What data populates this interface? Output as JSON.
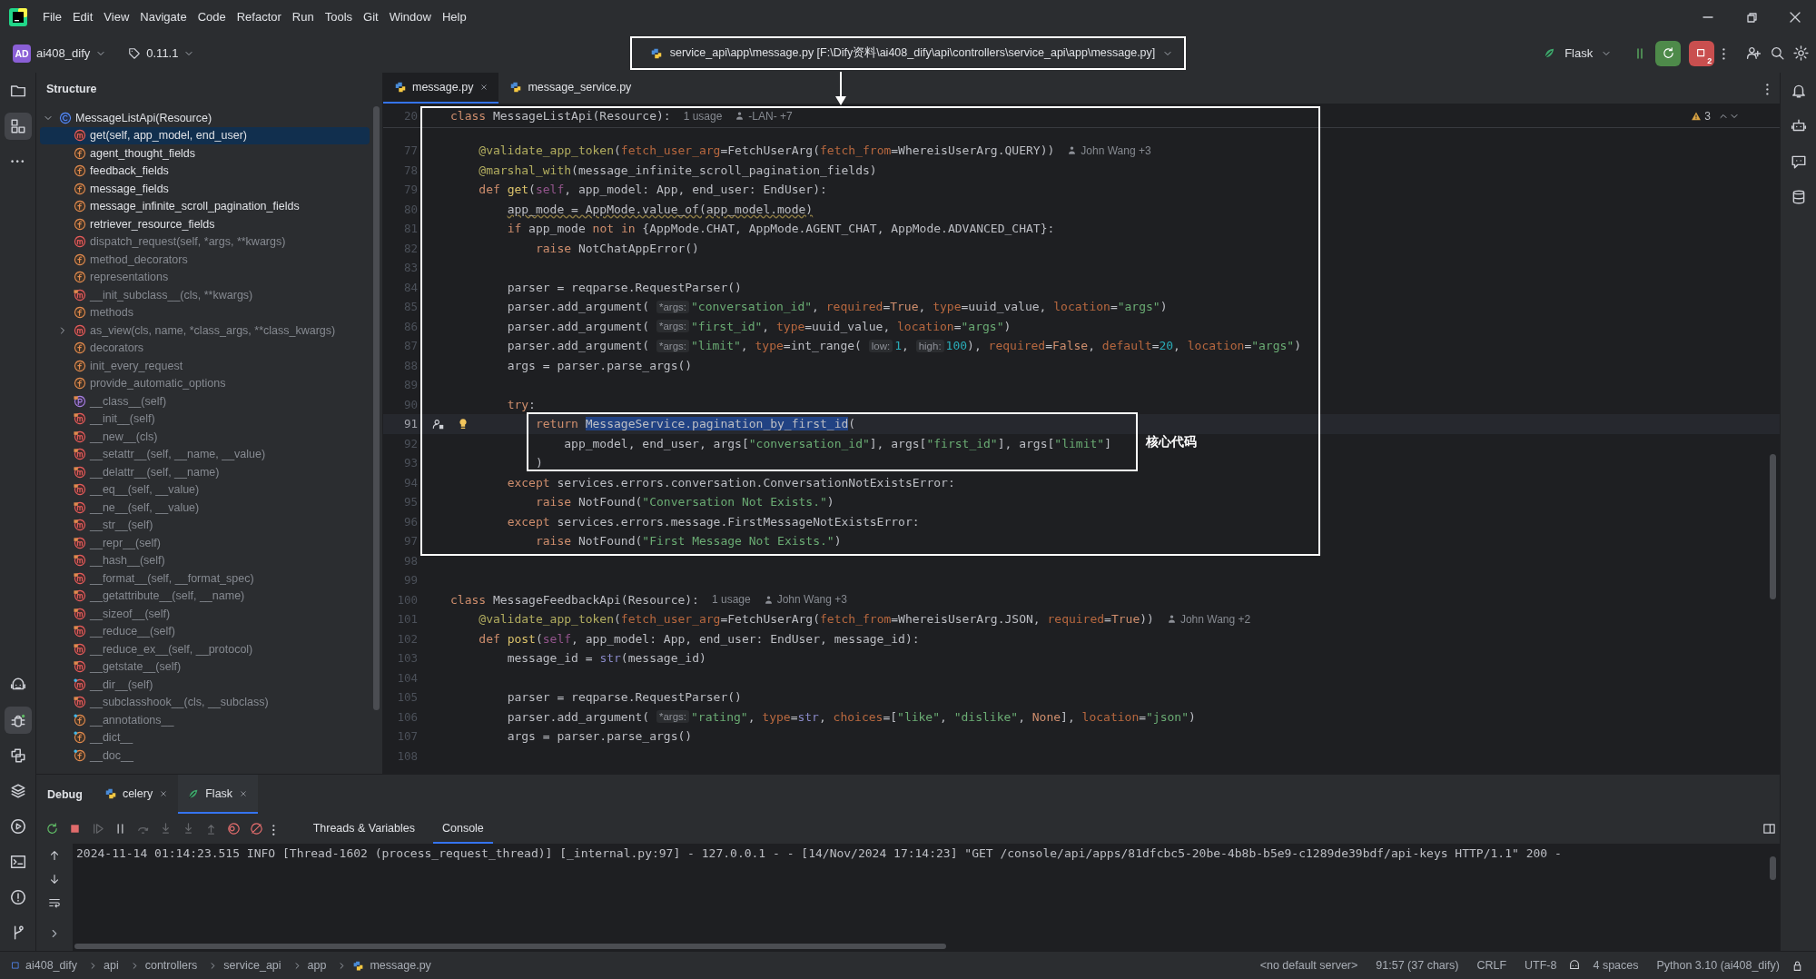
{
  "menu": [
    "File",
    "Edit",
    "View",
    "Navigate",
    "Code",
    "Refactor",
    "Run",
    "Tools",
    "Git",
    "Window",
    "Help"
  ],
  "toolbar": {
    "project_initials": "AD",
    "project": "ai408_dify",
    "version": "0.11.1",
    "file_path": "service_api\\app\\message.py [F:\\Dify资料\\ai408_dify\\api\\controllers\\service_api\\app\\message.py]",
    "run_config": "Flask",
    "stop_badge": "2"
  },
  "left_strip": {
    "top": [
      {
        "kind": "folder",
        "selected": false
      },
      {
        "kind": "structure",
        "selected": true
      },
      {
        "kind": "more",
        "selected": false
      }
    ],
    "bottom": [
      {
        "kind": "robot",
        "selected": false
      },
      {
        "kind": "bug",
        "selected": true
      },
      {
        "kind": "python",
        "selected": false
      },
      {
        "kind": "layers",
        "selected": false
      },
      {
        "kind": "run",
        "selected": false
      },
      {
        "kind": "terminal",
        "selected": false
      },
      {
        "kind": "problems",
        "selected": false
      },
      {
        "kind": "git",
        "selected": false
      }
    ]
  },
  "right_strip": [
    {
      "kind": "bell"
    },
    {
      "kind": "ai"
    },
    {
      "kind": "ai-chat"
    },
    {
      "kind": "database"
    }
  ],
  "structure": {
    "title": "Structure",
    "root": {
      "label": "MessageListApi(Resource)",
      "expanded": true,
      "children": [
        {
          "label": "get(self, app_model, end_user)",
          "kind": "method",
          "inherited": false,
          "expandable": false,
          "selected": true
        },
        {
          "label": "agent_thought_fields",
          "kind": "field",
          "inherited": false,
          "expandable": false,
          "selected": false
        },
        {
          "label": "feedback_fields",
          "kind": "field",
          "inherited": false,
          "expandable": false,
          "selected": false
        },
        {
          "label": "message_fields",
          "kind": "field",
          "inherited": false,
          "expandable": false,
          "selected": false
        },
        {
          "label": "message_infinite_scroll_pagination_fields",
          "kind": "field",
          "inherited": false,
          "expandable": false,
          "selected": false
        },
        {
          "label": "retriever_resource_fields",
          "kind": "field",
          "inherited": false,
          "expandable": false,
          "selected": false
        },
        {
          "label": "dispatch_request(self, *args, **kwargs)",
          "kind": "method",
          "inherited": true,
          "expandable": false,
          "selected": false
        },
        {
          "label": "method_decorators",
          "kind": "field",
          "inherited": true,
          "expandable": false,
          "selected": false
        },
        {
          "label": "representations",
          "kind": "field",
          "inherited": true,
          "expandable": false,
          "selected": false
        },
        {
          "label": "__init_subclass__(cls, **kwargs)",
          "kind": "method-lock",
          "inherited": true,
          "expandable": false,
          "selected": false
        },
        {
          "label": "methods",
          "kind": "field",
          "inherited": true,
          "expandable": false,
          "selected": false
        },
        {
          "label": "as_view(cls, name, *class_args, **class_kwargs)",
          "kind": "method",
          "inherited": true,
          "expandable": true,
          "selected": false
        },
        {
          "label": "decorators",
          "kind": "field",
          "inherited": true,
          "expandable": false,
          "selected": false
        },
        {
          "label": "init_every_request",
          "kind": "field",
          "inherited": true,
          "expandable": false,
          "selected": false
        },
        {
          "label": "provide_automatic_options",
          "kind": "field",
          "inherited": true,
          "expandable": false,
          "selected": false
        },
        {
          "label": "__class__(self)",
          "kind": "property-lock",
          "inherited": true,
          "expandable": false,
          "selected": false
        },
        {
          "label": "__init__(self)",
          "kind": "method-lock",
          "inherited": true,
          "expandable": false,
          "selected": false
        },
        {
          "label": "__new__(cls)",
          "kind": "method-lock",
          "inherited": true,
          "expandable": false,
          "selected": false
        },
        {
          "label": "__setattr__(self, __name, __value)",
          "kind": "method-lock",
          "inherited": true,
          "expandable": false,
          "selected": false
        },
        {
          "label": "__delattr__(self, __name)",
          "kind": "method-lock",
          "inherited": true,
          "expandable": false,
          "selected": false
        },
        {
          "label": "__eq__(self, __value)",
          "kind": "method-lock",
          "inherited": true,
          "expandable": false,
          "selected": false
        },
        {
          "label": "__ne__(self, __value)",
          "kind": "method-lock",
          "inherited": true,
          "expandable": false,
          "selected": false
        },
        {
          "label": "__str__(self)",
          "kind": "method-lock",
          "inherited": true,
          "expandable": false,
          "selected": false
        },
        {
          "label": "__repr__(self)",
          "kind": "method-lock",
          "inherited": true,
          "expandable": false,
          "selected": false
        },
        {
          "label": "__hash__(self)",
          "kind": "method-lock",
          "inherited": true,
          "expandable": false,
          "selected": false
        },
        {
          "label": "__format__(self, __format_spec)",
          "kind": "method-lock",
          "inherited": true,
          "expandable": false,
          "selected": false
        },
        {
          "label": "__getattribute__(self, __name)",
          "kind": "method-lock",
          "inherited": true,
          "expandable": false,
          "selected": false
        },
        {
          "label": "__sizeof__(self)",
          "kind": "method-lock",
          "inherited": true,
          "expandable": false,
          "selected": false
        },
        {
          "label": "__reduce__(self)",
          "kind": "method-lock",
          "inherited": true,
          "expandable": false,
          "selected": false
        },
        {
          "label": "__reduce_ex__(self, __protocol)",
          "kind": "method-lock",
          "inherited": true,
          "expandable": false,
          "selected": false
        },
        {
          "label": "__getstate__(self)",
          "kind": "method-lock",
          "inherited": true,
          "expandable": false,
          "selected": false
        },
        {
          "label": "__dir__(self)",
          "kind": "method-dot",
          "inherited": true,
          "expandable": false,
          "selected": false
        },
        {
          "label": "__subclasshook__(cls, __subclass)",
          "kind": "method-lock",
          "inherited": true,
          "expandable": false,
          "selected": false
        },
        {
          "label": "__annotations__",
          "kind": "field-dot",
          "inherited": true,
          "expandable": false,
          "selected": false
        },
        {
          "label": "__dict__",
          "kind": "field-dot",
          "inherited": true,
          "expandable": false,
          "selected": false
        },
        {
          "label": "__doc__",
          "kind": "field-dot",
          "inherited": true,
          "expandable": false,
          "selected": false
        }
      ]
    }
  },
  "editor": {
    "tabs": [
      {
        "label": "message.py",
        "selected": true,
        "closable": true
      },
      {
        "label": "message_service.py",
        "selected": false,
        "closable": false
      }
    ],
    "warnings": "3",
    "sticky_line": {
      "number": "20",
      "parts": [
        {
          "kind": "code",
          "text": "class MessageListApi(Resource):"
        }
      ],
      "usages": "1 usage",
      "blame": "-LAN- +7"
    },
    "lines": [
      {
        "number": "77",
        "current": false,
        "parts": [
          {
            "kind": "code",
            "text": "    @validate_app_token(fetch_user_arg=FetchUserArg(fetch_from=WhereisUserArg.QUERY))"
          }
        ],
        "blame": "John Wang +3"
      },
      {
        "number": "78",
        "current": false,
        "parts": [
          {
            "kind": "code",
            "text": "    @marshal_with(message_infinite_scroll_pagination_fields)"
          }
        ]
      },
      {
        "number": "79",
        "current": false,
        "parts": [
          {
            "kind": "code",
            "text": "    def get(self, app_model: App, end_user: EndUser):"
          }
        ]
      },
      {
        "number": "80",
        "current": false,
        "parts": [
          {
            "kind": "warning",
            "text": "        app_mode = AppMode.value_of(app_model.mode)"
          }
        ]
      },
      {
        "number": "81",
        "current": false,
        "parts": [
          {
            "kind": "code",
            "text": "        if app_mode not in {AppMode.CHAT, AppMode.AGENT_CHAT, AppMode.ADVANCED_CHAT}:"
          }
        ]
      },
      {
        "number": "82",
        "current": false,
        "parts": [
          {
            "kind": "code",
            "text": "            raise NotChatAppError()"
          }
        ]
      },
      {
        "number": "83",
        "current": false
      },
      {
        "number": "84",
        "current": false,
        "parts": [
          {
            "kind": "code",
            "text": "        parser = reqparse.RequestParser()"
          }
        ]
      },
      {
        "number": "85",
        "current": false,
        "parts": [
          {
            "kind": "code",
            "text": "        parser.add_argument( "
          },
          {
            "kind": "hint",
            "text": "*args:"
          },
          {
            "kind": "code",
            "text": "\"conversation_id\", required=True, type=uuid_value, location=\"args\")"
          }
        ]
      },
      {
        "number": "86",
        "current": false,
        "parts": [
          {
            "kind": "code",
            "text": "        parser.add_argument( "
          },
          {
            "kind": "hint",
            "text": "*args:"
          },
          {
            "kind": "code",
            "text": "\"first_id\", type=uuid_value, location=\"args\")"
          }
        ]
      },
      {
        "number": "87",
        "current": false,
        "parts": [
          {
            "kind": "code",
            "text": "        parser.add_argument( "
          },
          {
            "kind": "hint",
            "text": "*args:"
          },
          {
            "kind": "code",
            "text": "\"limit\", type=int_range( "
          },
          {
            "kind": "hint",
            "text": "low:"
          },
          {
            "kind": "code",
            "text": "1, "
          },
          {
            "kind": "hint",
            "text": "high:"
          },
          {
            "kind": "code",
            "text": "100), required=False, default=20, location=\"args\")"
          }
        ]
      },
      {
        "number": "88",
        "current": false,
        "parts": [
          {
            "kind": "code",
            "text": "        args = parser.parse_args()"
          }
        ]
      },
      {
        "number": "89",
        "current": false
      },
      {
        "number": "90",
        "current": false,
        "parts": [
          {
            "kind": "code",
            "text": "        try:"
          }
        ]
      },
      {
        "number": "91",
        "current": true,
        "parts": [
          {
            "kind": "code",
            "text": "            return "
          },
          {
            "kind": "selection",
            "text": "MessageService.pagination_by_first_id"
          },
          {
            "kind": "code",
            "text": "("
          }
        ]
      },
      {
        "number": "92",
        "current": false,
        "parts": [
          {
            "kind": "code",
            "text": "                app_model, end_user, args[\"conversation_id\"], args[\"first_id\"], args[\"limit\"]"
          }
        ]
      },
      {
        "number": "93",
        "current": false,
        "parts": [
          {
            "kind": "code",
            "text": "            )"
          }
        ]
      },
      {
        "number": "94",
        "current": false,
        "parts": [
          {
            "kind": "code",
            "text": "        except services.errors.conversation.ConversationNotExistsError:"
          }
        ]
      },
      {
        "number": "95",
        "current": false,
        "parts": [
          {
            "kind": "code",
            "text": "            raise NotFound(\"Conversation Not Exists.\")"
          }
        ]
      },
      {
        "number": "96",
        "current": false,
        "parts": [
          {
            "kind": "code",
            "text": "        except services.errors.message.FirstMessageNotExistsError:"
          }
        ]
      },
      {
        "number": "97",
        "current": false,
        "parts": [
          {
            "kind": "code",
            "text": "            raise NotFound(\"First Message Not Exists.\")"
          }
        ]
      },
      {
        "number": "98",
        "current": false
      },
      {
        "number": "99",
        "current": false
      },
      {
        "number": "100",
        "current": false,
        "parts": [
          {
            "kind": "code",
            "text": "class MessageFeedbackApi(Resource):"
          }
        ],
        "usages": "1 usage",
        "blame": "John Wang +3"
      },
      {
        "number": "101",
        "current": false,
        "parts": [
          {
            "kind": "code",
            "text": "    @validate_app_token(fetch_user_arg=FetchUserArg(fetch_from=WhereisUserArg.JSON, required=True))"
          }
        ],
        "blame": "John Wang +2"
      },
      {
        "number": "102",
        "current": false,
        "parts": [
          {
            "kind": "code",
            "text": "    def post(self, app_model: App, end_user: EndUser, message_id):"
          }
        ]
      },
      {
        "number": "103",
        "current": false,
        "parts": [
          {
            "kind": "code",
            "text": "        message_id = str(message_id)"
          }
        ]
      },
      {
        "number": "104",
        "current": false
      },
      {
        "number": "105",
        "current": false,
        "parts": [
          {
            "kind": "code",
            "text": "        parser = reqparse.RequestParser()"
          }
        ]
      },
      {
        "number": "106",
        "current": false,
        "parts": [
          {
            "kind": "code",
            "text": "        parser.add_argument( "
          },
          {
            "kind": "hint",
            "text": "*args:"
          },
          {
            "kind": "code",
            "text": "\"rating\", type=str, choices=[\"like\", \"dislike\", None], location=\"json\")"
          }
        ]
      },
      {
        "number": "107",
        "current": false,
        "parts": [
          {
            "kind": "code",
            "text": "        args = parser.parse_args()"
          }
        ]
      },
      {
        "number": "108",
        "current": false
      }
    ]
  },
  "annotation": {
    "label": "核心代码"
  },
  "debug": {
    "title": "Debug",
    "sessions": [
      {
        "label": "celery",
        "kind": "python",
        "selected": false
      },
      {
        "label": "Flask",
        "kind": "flask",
        "selected": true
      }
    ],
    "actions": [
      {
        "kind": "rerun",
        "disabled": false
      },
      {
        "kind": "stop",
        "disabled": false
      },
      {
        "kind": "resume",
        "disabled": true
      },
      {
        "kind": "pause",
        "disabled": false
      },
      {
        "kind": "step-over",
        "disabled": true
      },
      {
        "kind": "step-into",
        "disabled": true
      },
      {
        "kind": "step-into",
        "disabled": true
      },
      {
        "kind": "step-out",
        "disabled": true
      },
      {
        "kind": "breakpoints",
        "disabled": false
      },
      {
        "kind": "mute",
        "disabled": false
      },
      {
        "kind": "more",
        "disabled": false
      }
    ],
    "tabs": [
      {
        "label": "Threads & Variables",
        "selected": false
      },
      {
        "label": "Console",
        "selected": true
      }
    ],
    "console": [
      "2024-11-14 01:14:23.515 INFO [Thread-1602 (process_request_thread)] [_internal.py:97] - 127.0.0.1 - - [14/Nov/2024 17:14:23] \"GET /console/api/apps/81dfcbc5-20be-4b8b-b5e9-c1289de39bdf/api-keys HTTP/1.1\" 200 -"
    ]
  },
  "status_bar": {
    "breadcrumbs": [
      "ai408_dify",
      "api",
      "controllers",
      "service_api",
      "app",
      "message.py"
    ],
    "server": "<no default server>",
    "position": "91:57 (37 chars)",
    "line_separator": "CRLF",
    "encoding": "UTF-8",
    "indent": "4 spaces",
    "interpreter": "Python 3.10 (ai408_dify)"
  }
}
